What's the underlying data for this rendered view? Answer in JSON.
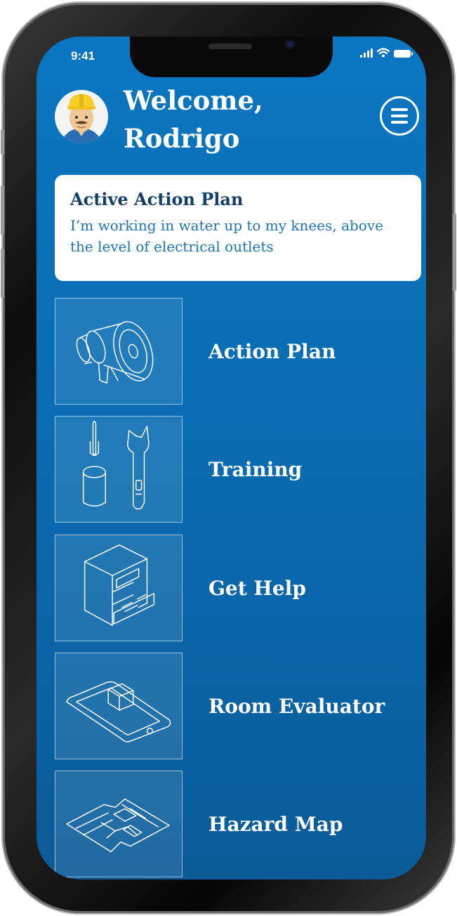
{
  "status_bar": {
    "time": "9:41"
  },
  "header": {
    "welcome_line1": "Welcome,",
    "welcome_line2": "Rodrigo"
  },
  "active_plan": {
    "title": "Active Action Plan",
    "description": "I’m working in water up to my knees, above the level of electrical outlets"
  },
  "menu": {
    "items": [
      {
        "label": "Action Plan",
        "icon": "megaphone-icon"
      },
      {
        "label": "Training",
        "icon": "tools-icon"
      },
      {
        "label": "Get Help",
        "icon": "filing-cabinet-icon"
      },
      {
        "label": "Room Evaluator",
        "icon": "phone-ar-icon"
      },
      {
        "label": "Hazard Map",
        "icon": "map-icon"
      }
    ]
  },
  "colors": {
    "background_top": "#0a76c2",
    "background_bottom": "#0a5b98",
    "card_title": "#143e6a",
    "card_text": "#1a73b8"
  }
}
